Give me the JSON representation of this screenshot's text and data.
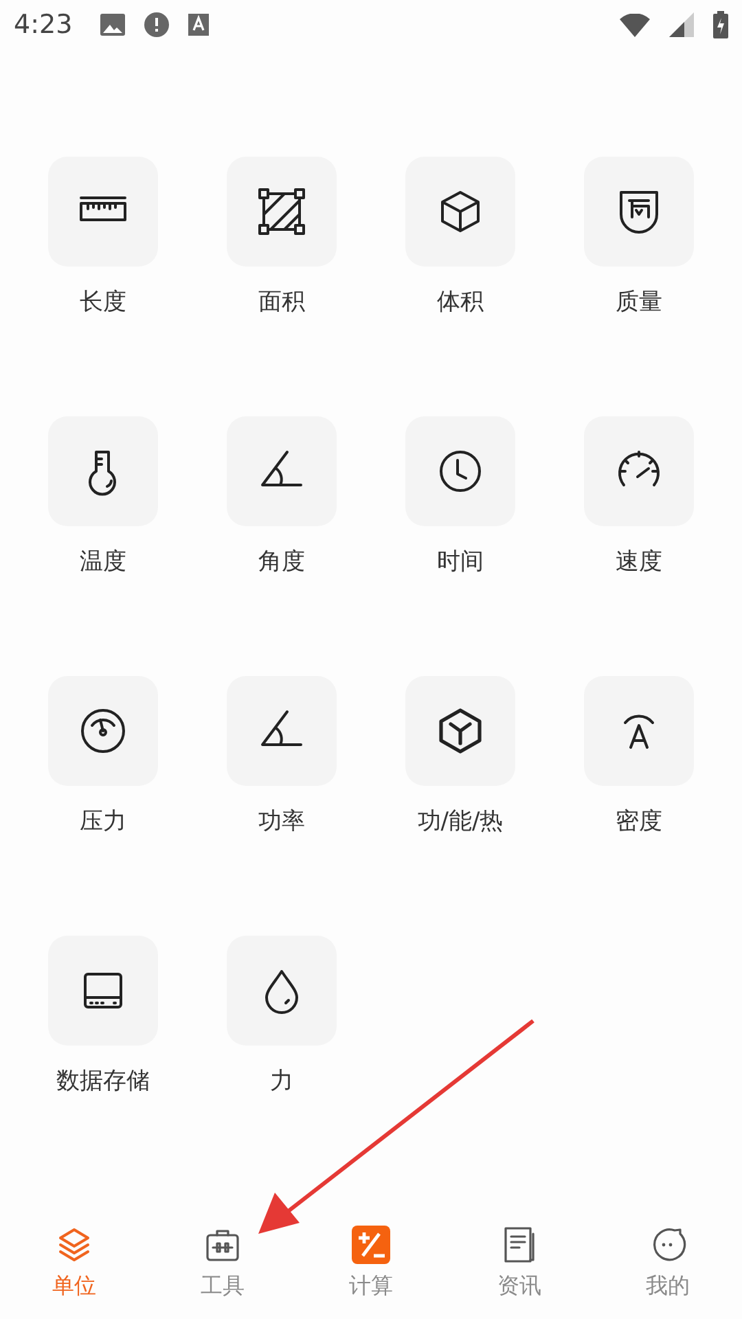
{
  "status_bar": {
    "time": "4:23"
  },
  "units": [
    {
      "label": "长度"
    },
    {
      "label": "面积"
    },
    {
      "label": "体积"
    },
    {
      "label": "质量"
    },
    {
      "label": "温度"
    },
    {
      "label": "角度"
    },
    {
      "label": "时间"
    },
    {
      "label": "速度"
    },
    {
      "label": "压力"
    },
    {
      "label": "功率"
    },
    {
      "label": "功/能/热"
    },
    {
      "label": "密度"
    },
    {
      "label": "数据存储"
    },
    {
      "label": "力"
    }
  ],
  "tab_bar": [
    {
      "label": "单位",
      "selected": true
    },
    {
      "label": "工具",
      "selected": false
    },
    {
      "label": "计算",
      "selected": false
    },
    {
      "label": "资讯",
      "selected": false
    },
    {
      "label": "我的",
      "selected": false
    }
  ],
  "annotation": {
    "kind": "arrow"
  }
}
